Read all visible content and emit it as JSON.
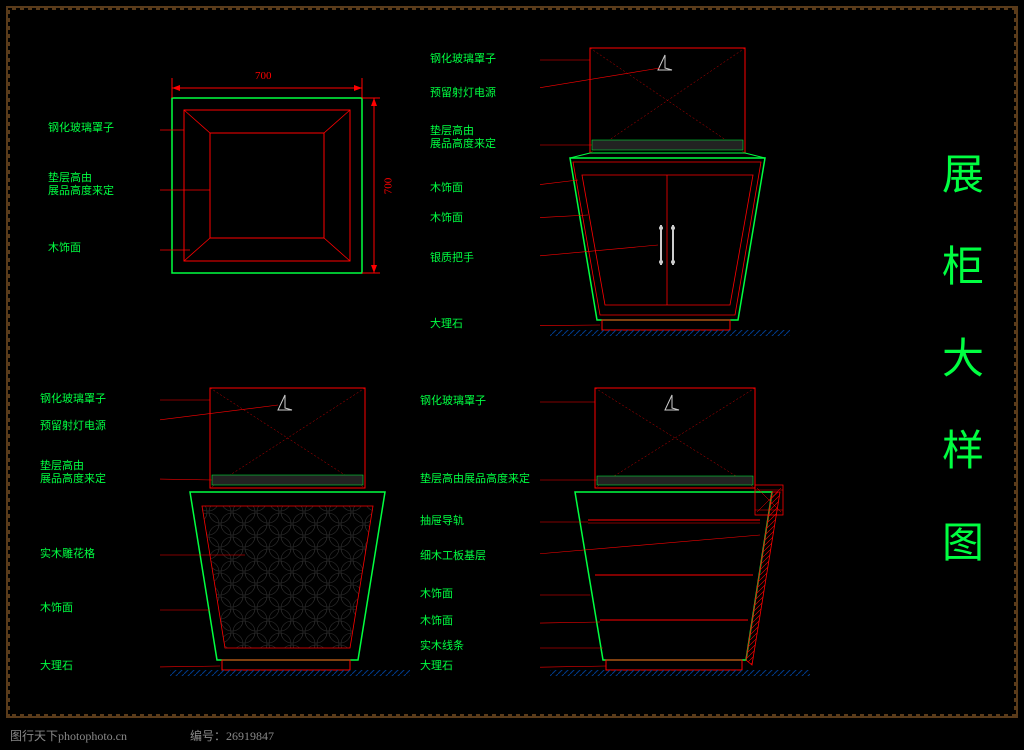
{
  "title_vertical": "展柜大样图",
  "footer_text": "图行天下photophoto.cn",
  "footer_id": "编号：26919847",
  "dimensions": {
    "width": "700",
    "height": "700"
  },
  "view_top": {
    "labels": {
      "glass_cover": "钢化玻璃罩子",
      "shelf_height": "垫层高由\n展品高度来定",
      "wood_finish": "木饰面"
    }
  },
  "view_front": {
    "labels": {
      "glass_cover": "钢化玻璃罩子",
      "light_power": "预留射灯电源",
      "shelf_height": "垫层高由\n展品高度来定",
      "wood_finish_upper": "木饰面",
      "wood_finish_lower": "木饰面",
      "handle": "银质把手",
      "marble": "大理石"
    }
  },
  "view_side": {
    "labels": {
      "glass_cover": "钢化玻璃罩子",
      "light_power": "预留射灯电源",
      "shelf_height": "垫层高由\n展品高度来定",
      "carving": "实木雕花格",
      "wood_finish": "木饰面",
      "marble": "大理石"
    }
  },
  "view_section": {
    "labels": {
      "glass_cover": "钢化玻璃罩子",
      "shelf_height": "垫层高由展品高度来定",
      "drawer_rail": "抽屉导轨",
      "plywood": "细木工板基层",
      "wood_finish_upper": "木饰面",
      "wood_finish_lower": "木饰面",
      "wood_trim": "实木线条",
      "marble": "大理石"
    }
  }
}
